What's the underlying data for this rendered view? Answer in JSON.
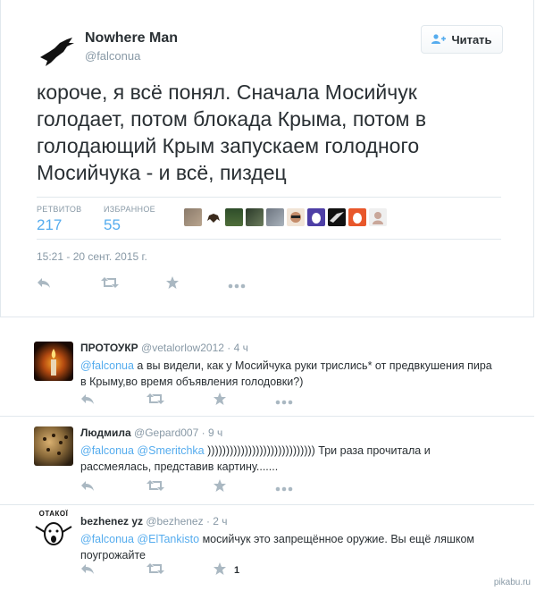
{
  "tweet": {
    "display_name": "Nowhere Man",
    "screen_name": "@falconua",
    "follow_label": "Читать",
    "text": "короче, я всё понял. Сначала Мосийчук голодает, потом блокада Крыма, потом в голодающий Крым запускаем голодного Мосийчука - и всё, пиздец",
    "retweets_label": "РЕТВИТОВ",
    "retweets": "217",
    "favorites_label": "ИЗБРАННОЕ",
    "favorites": "55",
    "timestamp": "15:21 - 20 сент. 2015 г."
  },
  "replies": [
    {
      "name": "ПРОТОУКР",
      "handle": "@vetalorlow2012",
      "time": "· 4 ч",
      "mention": "@falconua",
      "text": " а вы видели, как у Мосийчука руки трислись* от предвкушения пира в Крыму,во время объявления голодовки?)",
      "fav_count": ""
    },
    {
      "name": "Людмила",
      "handle": "@Gepard007",
      "time": "· 9 ч",
      "mention": "@falconua @Smeritchka",
      "text": " ))))))))))))))))))))))))))))) Три раза прочитала и рассмеялась, представив  картину.......",
      "fav_count": ""
    },
    {
      "name": "bezhenez yz",
      "handle": "@bezhenez",
      "time": "· 2 ч",
      "mention": "@falconua @ElTankisto",
      "text": " мосийчук это запрещённое оружие. Вы ещё ляшком поугрожайте",
      "fav_count": "1",
      "avatar_caption": "ОТАКОЇ"
    }
  ],
  "watermark": "pikabu.ru",
  "colors": {
    "accent": "#55acee",
    "muted": "#8899a6",
    "text": "#292f33",
    "icon": "#aab8c2"
  }
}
